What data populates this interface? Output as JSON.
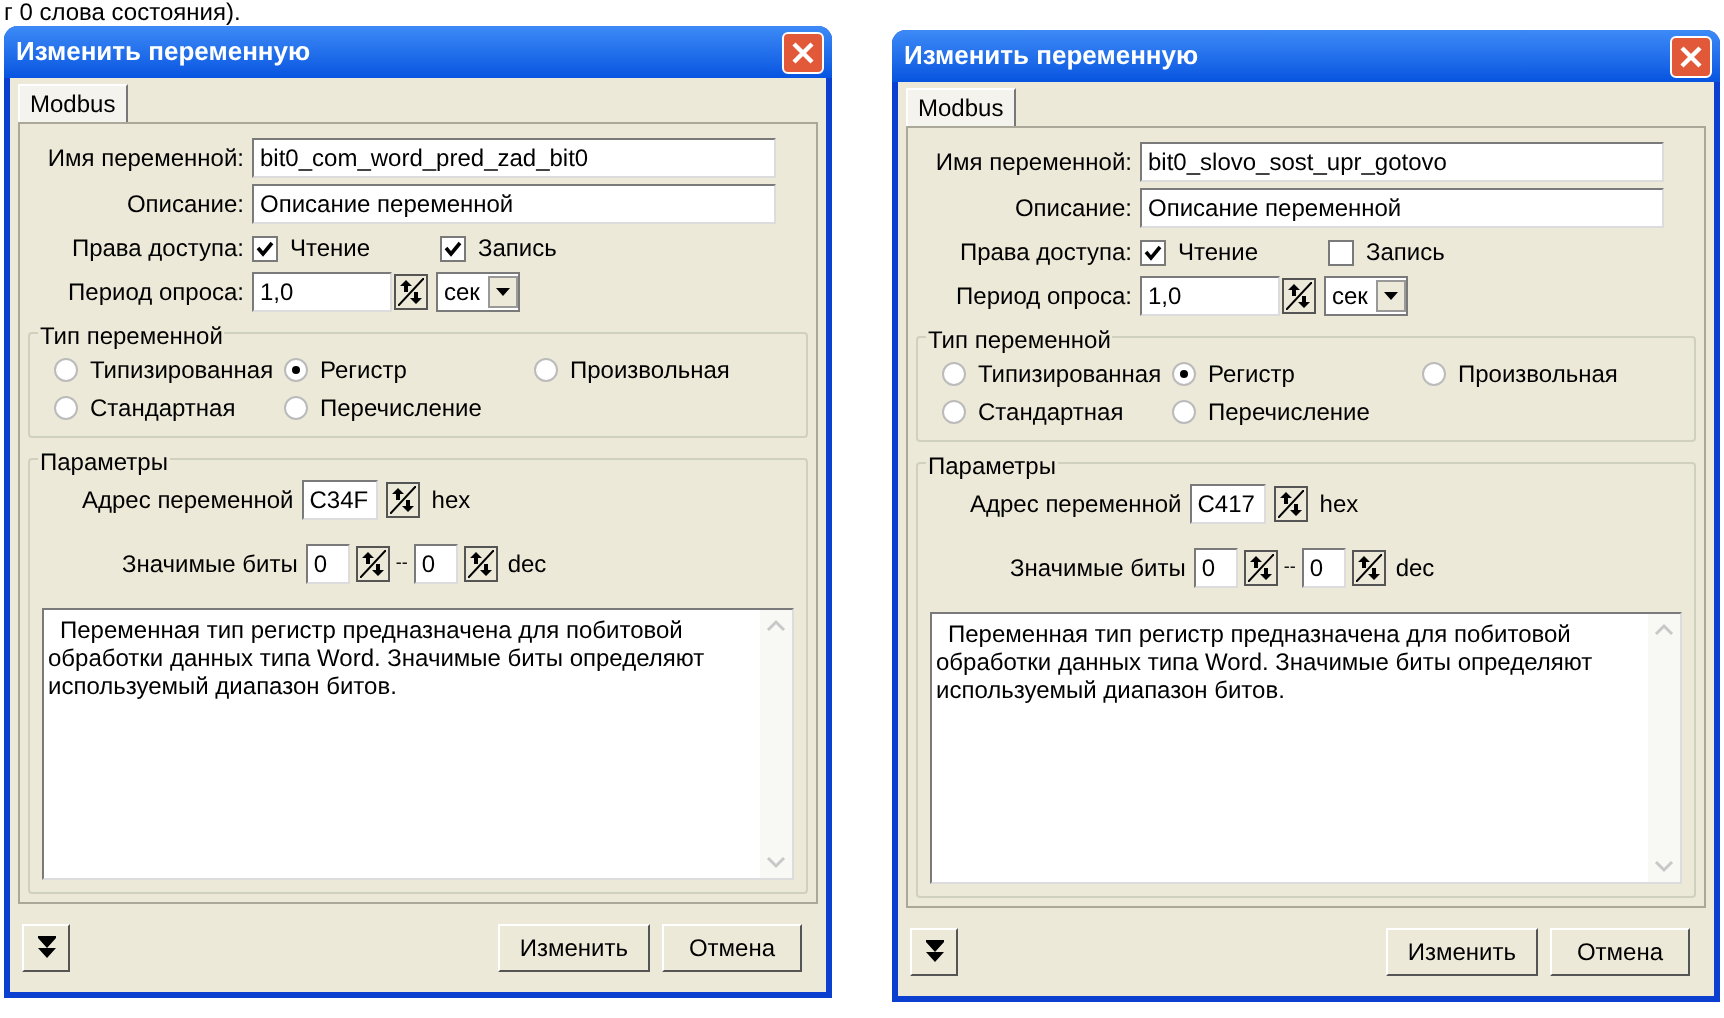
{
  "caption_fragment": "г 0 слова состояния).",
  "dialogs": [
    {
      "title": "Изменить переменную",
      "tab": {
        "label": "Modbus",
        "selected": true
      },
      "name_field": {
        "label": "Имя переменной:",
        "value": "bit0_com_word_pred_zad_bit0"
      },
      "description_field": {
        "label": "Описание:",
        "value": "Описание переменной"
      },
      "access": {
        "label": "Права доступа:",
        "options": [
          {
            "label": "Чтение",
            "checked": true
          },
          {
            "label": "Запись",
            "checked": true
          }
        ]
      },
      "period": {
        "label": "Период опроса:",
        "value": "1,0",
        "unit": "сек"
      },
      "type_group": {
        "title": "Тип переменной",
        "options": [
          {
            "label": "Типизированная",
            "selected": false
          },
          {
            "label": "Регистр",
            "selected": true
          },
          {
            "label": "Произвольная",
            "selected": false
          },
          {
            "label": "Стандартная",
            "selected": false
          },
          {
            "label": "Перечисление",
            "selected": false
          }
        ]
      },
      "params": {
        "title": "Параметры",
        "address": {
          "label": "Адрес переменной",
          "value": "C34F",
          "unit": "hex"
        },
        "bits": {
          "label": "Значимые биты",
          "from": "0",
          "separator": "--",
          "to": "0",
          "unit": "dec"
        },
        "description": "Переменная тип регистр предназначена для побитовой обработки данных типа Word. Значимые биты определяют используемый диапазон битов."
      },
      "buttons": [
        "Изменить",
        "Отмена"
      ]
    },
    {
      "title": "Изменить переменную",
      "tab": {
        "label": "Modbus",
        "selected": true
      },
      "name_field": {
        "label": "Имя переменной:",
        "value": "bit0_slovo_sost_upr_gotovo"
      },
      "description_field": {
        "label": "Описание:",
        "value": "Описание переменной"
      },
      "access": {
        "label": "Права доступа:",
        "options": [
          {
            "label": "Чтение",
            "checked": true
          },
          {
            "label": "Запись",
            "checked": false
          }
        ]
      },
      "period": {
        "label": "Период опроса:",
        "value": "1,0",
        "unit": "сек"
      },
      "type_group": {
        "title": "Тип переменной",
        "options": [
          {
            "label": "Типизированная",
            "selected": false
          },
          {
            "label": "Регистр",
            "selected": true
          },
          {
            "label": "Произвольная",
            "selected": false
          },
          {
            "label": "Стандартная",
            "selected": false
          },
          {
            "label": "Перечисление",
            "selected": false
          }
        ]
      },
      "params": {
        "title": "Параметры",
        "address": {
          "label": "Адрес переменной",
          "value": "C417",
          "unit": "hex"
        },
        "bits": {
          "label": "Значимые биты",
          "from": "0",
          "separator": "--",
          "to": "0",
          "unit": "dec"
        },
        "description": "Переменная тип регистр предназначена для побитовой обработки данных типа Word. Значимые биты определяют используемый диапазон битов."
      },
      "buttons": [
        "Изменить",
        "Отмена"
      ]
    }
  ]
}
